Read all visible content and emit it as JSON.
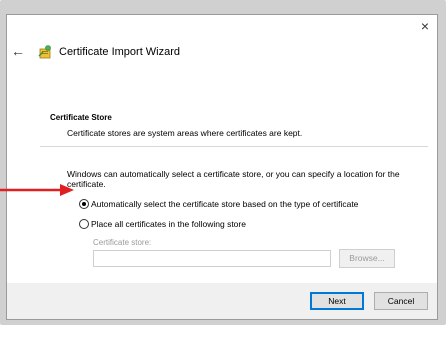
{
  "window": {
    "close_glyph": "×",
    "back_glyph": "←",
    "title": "Certificate Import Wizard",
    "icon": "certificate-wizard-icon"
  },
  "section": {
    "heading": "Certificate Store",
    "description": "Certificate stores are system areas where certificates are kept."
  },
  "intro": "Windows can automatically select a certificate store, or you can specify a location for the certificate.",
  "options": [
    {
      "label": "Automatically select the certificate store based on the type of certificate",
      "selected": true
    },
    {
      "label": "Place all certificates in the following store",
      "selected": false
    }
  ],
  "store": {
    "label": "Certificate store:",
    "value": "",
    "browse_label": "Browse..."
  },
  "footer": {
    "next_label": "Next",
    "cancel_label": "Cancel"
  },
  "colors": {
    "annotation_arrow": "#e02020",
    "primary_border": "#0078d7"
  }
}
